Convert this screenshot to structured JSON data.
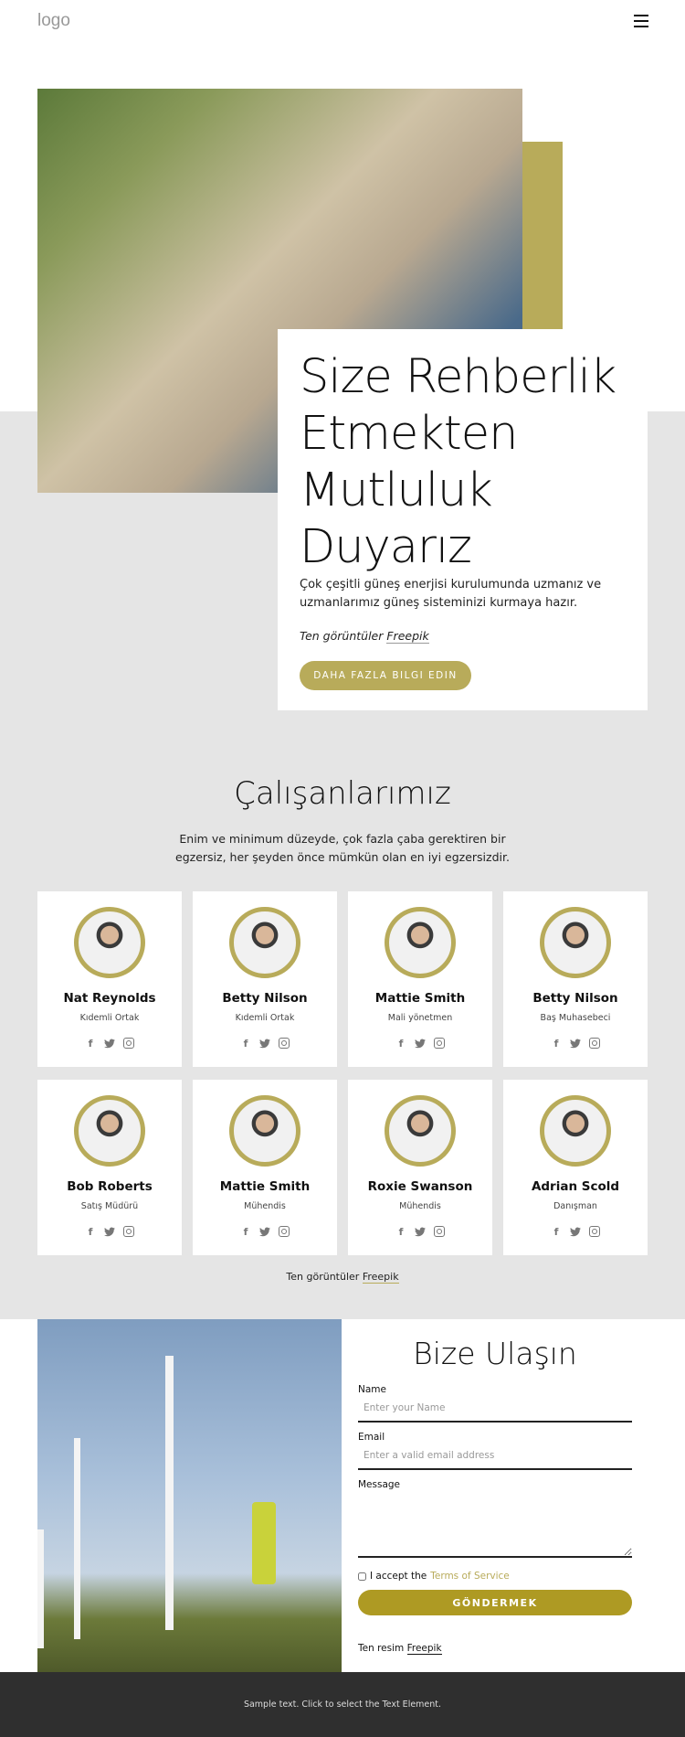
{
  "header": {
    "logo": "logo",
    "menu_icon": "hamburger-icon"
  },
  "hero": {
    "title": "Size Rehberlik Etmekten Mutluluk Duyarız",
    "text": "Çok çeşitli güneş enerjisi kurulumunda uzmanız ve uzmanlarımız güneş sisteminizi kurmaya hazır.",
    "credit_prefix": "Ten görüntüler",
    "credit_link": "Freepik",
    "button": "DAHA FAZLA BILGI EDIN"
  },
  "team": {
    "title": "Çalışanlarımız",
    "subtitle": "Enim ve minimum düzeyde, çok fazla çaba gerektiren bir egzersiz, her şeyden önce mümkün olan en iyi egzersizdir.",
    "members": [
      {
        "name": "Nat Reynolds",
        "role": "Kıdemli Ortak"
      },
      {
        "name": "Betty Nilson",
        "role": "Kıdemli Ortak"
      },
      {
        "name": "Mattie Smith",
        "role": "Mali yönetmen"
      },
      {
        "name": "Betty Nilson",
        "role": "Baş Muhasebeci"
      },
      {
        "name": "Bob Roberts",
        "role": "Satış Müdürü"
      },
      {
        "name": "Mattie Smith",
        "role": "Mühendis"
      },
      {
        "name": "Roxie Swanson",
        "role": "Mühendis"
      },
      {
        "name": "Adrian Scold",
        "role": "Danışman"
      }
    ],
    "social_icons": [
      "facebook-icon",
      "twitter-icon",
      "instagram-icon"
    ],
    "credit_prefix": "Ten görüntüler",
    "credit_link": "Freepik"
  },
  "contact": {
    "title": "Bize Ulaşın",
    "name_label": "Name",
    "name_placeholder": "Enter your Name",
    "email_label": "Email",
    "email_placeholder": "Enter a valid email address",
    "message_label": "Message",
    "accept_text": "I accept the",
    "terms_link": "Terms of Service",
    "submit": "GÖNDERMEK",
    "credit_prefix": "Ten resim",
    "credit_link": "Freepik"
  },
  "footer": {
    "text": "Sample text. Click to select the Text Element."
  },
  "colors": {
    "accent": "#b8ab5a",
    "button": "#ae9a23",
    "gray_bg": "#e5e5e5",
    "footer_bg": "#2f2f2f"
  }
}
